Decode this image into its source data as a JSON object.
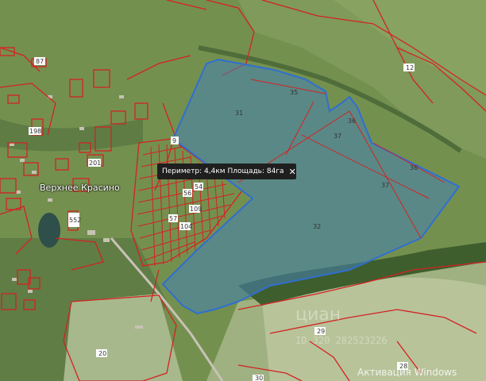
{
  "tooltip": {
    "text": "Периметр: 4,4км Площадь: 84га",
    "close": "✕"
  },
  "place_name": "Верхнее Красино",
  "parcel_labels": [
    "87",
    "12",
    "35",
    "31",
    "36",
    "37",
    "9",
    "37",
    "36",
    "37",
    "32",
    "198",
    "201",
    "552",
    "20",
    "29",
    "30",
    "28",
    "57",
    "104",
    "56",
    "54",
    "109"
  ],
  "watermark": {
    "brand": "циан",
    "id": "ID 320 282523226"
  },
  "system_notice": "Активация Windows",
  "colors": {
    "highlight_fill": "#4e89b8",
    "highlight_stroke": "#2f6fd1",
    "parcel_stroke": "#d42222"
  }
}
